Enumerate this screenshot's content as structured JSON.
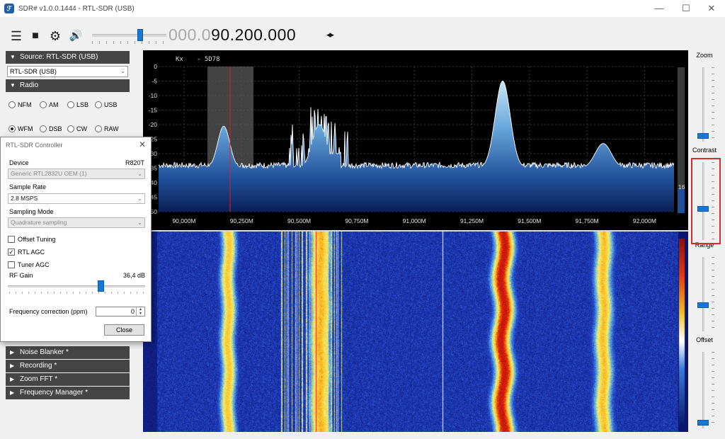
{
  "window": {
    "title": "SDR# v1.0.0.1444 - RTL-SDR (USB)",
    "minimize": "—",
    "maximize": "☐",
    "close": "✕"
  },
  "toolbar": {
    "menu_icon": "☰",
    "stop_icon": "■",
    "settings_icon": "⚙",
    "volume_icon": "🔊",
    "volume_level": 0.65,
    "frequency_dim": "000.0",
    "frequency_bright": "90.200.000",
    "freq_arrows": "◂▸"
  },
  "left_panel": {
    "source_header": "Source: RTL-SDR (USB)",
    "source_select": "RTL-SDR (USB)",
    "radio_header": "Radio",
    "modes": [
      {
        "label": "NFM",
        "selected": false
      },
      {
        "label": "AM",
        "selected": false
      },
      {
        "label": "LSB",
        "selected": false
      },
      {
        "label": "USB",
        "selected": false
      },
      {
        "label": "WFM",
        "selected": true
      },
      {
        "label": "DSB",
        "selected": false
      },
      {
        "label": "CW",
        "selected": false
      },
      {
        "label": "RAW",
        "selected": false
      }
    ],
    "bottom_sections": [
      "Noise Blanker *",
      "Recording *",
      "Zoom FFT *",
      "Frequency Manager *"
    ]
  },
  "dialog": {
    "title": "RTL-SDR Controller",
    "close_icon": "✕",
    "device_label": "Device",
    "device_model": "R820T",
    "device_value": "Generic RTL2832U OEM (1)",
    "sample_rate_label": "Sample Rate",
    "sample_rate_value": "2.8 MSPS",
    "sampling_mode_label": "Sampling Mode",
    "sampling_mode_value": "Quadrature sampling",
    "offset_tuning": "Offset Tuning",
    "offset_tuning_checked": false,
    "rtl_agc": "RTL AGC",
    "rtl_agc_checked": true,
    "tuner_agc": "Tuner AGC",
    "tuner_agc_checked": false,
    "rf_gain_label": "RF Gain",
    "rf_gain_value": "36,4 dB",
    "rf_gain_level": 0.67,
    "freq_corr_label": "Frequency correction (ppm)",
    "freq_corr_value": "0",
    "close_button": "Close"
  },
  "spectrum": {
    "header_a": "Kx",
    "header_b": "- 5D78",
    "y_ticks": [
      "0",
      "-5",
      "-10",
      "-15",
      "-20",
      "-25",
      "-30",
      "-35",
      "-40",
      "-45",
      "-50"
    ],
    "x_ticks": [
      "90,000M",
      "90,250M",
      "90,500M",
      "90,750M",
      "91,000M",
      "91,250M",
      "91,500M",
      "91,750M",
      "92,000M"
    ],
    "level_readout": "16"
  },
  "right_panel": {
    "zoom": "Zoom",
    "contrast": "Contrast",
    "range": "Range",
    "offset": "Offset"
  },
  "colors": {
    "accent": "#1976d2",
    "section_header": "#454545",
    "highlight_box": "#d32f2f"
  }
}
